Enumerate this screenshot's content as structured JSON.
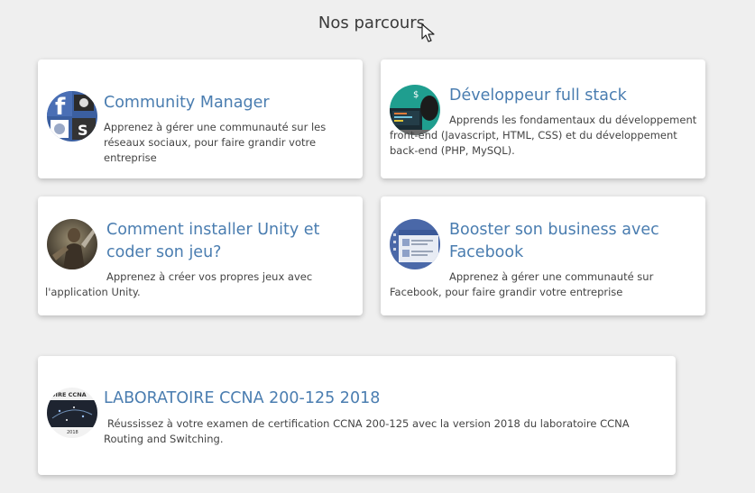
{
  "header": {
    "title": "Nos parcours"
  },
  "courses": [
    {
      "title": "Community Manager",
      "description": "Apprenez à gérer une communauté sur les réseaux sociaux, pour faire grandir votre entreprise",
      "thumbnail": "social-media-logos-thumbnail"
    },
    {
      "title": "Développeur full stack",
      "description": "Apprends les fondamentaux du développement front-end (Javascript, HTML, CSS) et du développement back-end (PHP, MySQL).",
      "thumbnail": "developer-at-laptop-thumbnail"
    },
    {
      "title": "Comment installer Unity et coder son jeu?",
      "description": "Apprenez à créer vos propres jeux avec l'application Unity.",
      "thumbnail": "game-character-thumbnail"
    },
    {
      "title": "Booster son business avec Facebook",
      "description": "Apprenez à gérer une communauté sur Facebook, pour faire grandir votre entreprise",
      "thumbnail": "facebook-page-thumbnail"
    },
    {
      "title": "LABORATOIRE CCNA 200-125 2018",
      "description": "Réussissez à votre examen de certification CCNA 200-125 avec la version 2018 du laboratoire CCNA Routing and Switching.",
      "thumbnail": "ccna-lab-thumbnail",
      "thumbnail_text": "OIRE CCNA",
      "thumbnail_year": "2018"
    }
  ],
  "colors": {
    "accent": "#4a7db0",
    "background": "#efefef",
    "card": "#ffffff"
  }
}
